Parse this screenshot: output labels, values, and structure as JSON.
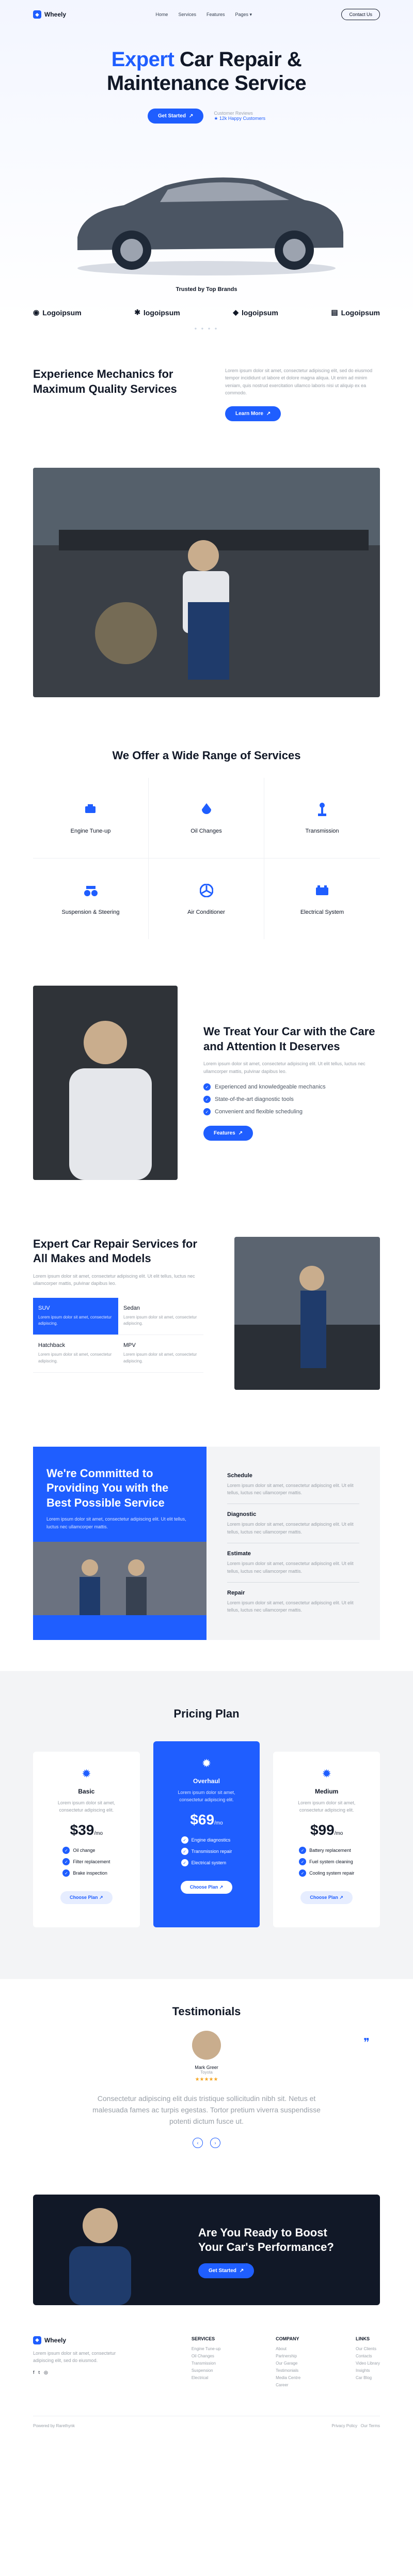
{
  "colors": {
    "accent": "#1f5eff",
    "dark": "#111827",
    "light_bg": "#f3f4f6"
  },
  "nav": {
    "brand": "Wheely",
    "menu": [
      "Home",
      "Services",
      "Features",
      "Pages"
    ],
    "contact": "Contact Us"
  },
  "hero": {
    "title_accent": "Expert",
    "title_rest_1": " Car Repair &",
    "title_rest_2": "Maintenance Service",
    "cta": "Get Started",
    "customers_label": "Customer Reviews",
    "customers_value": "12k Happy Customers"
  },
  "brands": {
    "title": "Trusted by Top Brands",
    "items": [
      "Logoipsum",
      "logoipsum",
      "logoipsum",
      "Logoipsum"
    ]
  },
  "intro": {
    "title": "Experience Mechanics for Maximum Quality Services",
    "body": "Lorem ipsum dolor sit amet, consectetur adipiscing elit, sed do eiusmod tempor incididunt ut labore et dolore magna aliqua. Ut enim ad minim veniam, quis nostrud exercitation ullamco laboris nisi ut aliquip ex ea commodo.",
    "cta": "Learn More"
  },
  "services": {
    "title": "We Offer a Wide Range of Services",
    "items": [
      {
        "label": "Engine Tune-up",
        "icon": "engine-icon"
      },
      {
        "label": "Oil Changes",
        "icon": "oil-icon"
      },
      {
        "label": "Transmission",
        "icon": "transmission-icon"
      },
      {
        "label": "Suspension & Steering",
        "icon": "suspension-icon"
      },
      {
        "label": "Air Conditioner",
        "icon": "fan-icon"
      },
      {
        "label": "Electrical System",
        "icon": "battery-icon"
      }
    ]
  },
  "treat": {
    "title": "We Treat Your Car with the Care and Attention It Deserves",
    "body": "Lorem ipsum dolor sit amet, consectetur adipiscing elit. Ut elit tellus, luctus nec ullamcorper mattis, pulvinar dapibus leo.",
    "checks": [
      "Experienced and knowledgeable mechanics",
      "State-of-the-art diagnostic tools",
      "Convenient and flexible scheduling"
    ],
    "cta": "Features"
  },
  "expert": {
    "title": "Expert Car Repair Services for All Makes and Models",
    "body": "Lorem ipsum dolor sit amet, consectetur adipiscing elit. Ut elit tellus, luctus nec ullamcorper mattis, pulvinar dapibus leo.",
    "types": [
      {
        "name": "SUV",
        "desc": "Lorem ipsum dolor sit amet, consectetur adipiscing."
      },
      {
        "name": "Sedan",
        "desc": "Lorem ipsum dolor sit amet, consectetur adipiscing."
      },
      {
        "name": "Hatchback",
        "desc": "Lorem ipsum dolor sit amet, consectetur adipiscing."
      },
      {
        "name": "MPV",
        "desc": "Lorem ipsum dolor sit amet, consectetur adipiscing."
      }
    ]
  },
  "commit": {
    "title": "We're Committed to Providing You with the Best Possible Service",
    "body": "Lorem ipsum dolor sit amet, consectetur adipiscing elit. Ut elit tellus, luctus nec ullamcorper mattis.",
    "items": [
      {
        "title": "Schedule",
        "desc": "Lorem ipsum dolor sit amet, consectetur adipiscing elit. Ut elit tellus, luctus nec ullamcorper mattis."
      },
      {
        "title": "Diagnostic",
        "desc": "Lorem ipsum dolor sit amet, consectetur adipiscing elit. Ut elit tellus, luctus nec ullamcorper mattis."
      },
      {
        "title": "Estimate",
        "desc": "Lorem ipsum dolor sit amet, consectetur adipiscing elit. Ut elit tellus, luctus nec ullamcorper mattis."
      },
      {
        "title": "Repair",
        "desc": "Lorem ipsum dolor sit amet, consectetur adipiscing elit. Ut elit tellus, luctus nec ullamcorper mattis."
      }
    ]
  },
  "pricing": {
    "title": "Pricing Plan",
    "plans": [
      {
        "name": "Basic",
        "desc": "Lorem ipsum dolor sit amet, consectetur adipiscing elit.",
        "price": "$39",
        "period": "/mo",
        "features": [
          "Oil change",
          "Filter replacement",
          "Brake inspection"
        ],
        "cta": "Choose Plan"
      },
      {
        "name": "Overhaul",
        "desc": "Lorem ipsum dolor sit amet, consectetur adipiscing elit.",
        "price": "$69",
        "period": "/mo",
        "features": [
          "Engine diagnostics",
          "Transmission repair",
          "Electrical system"
        ],
        "cta": "Choose Plan"
      },
      {
        "name": "Medium",
        "desc": "Lorem ipsum dolor sit amet, consectetur adipiscing elit.",
        "price": "$99",
        "period": "/mo",
        "features": [
          "Battery replacement",
          "Fuel system cleaning",
          "Cooling system repair"
        ],
        "cta": "Choose Plan"
      }
    ]
  },
  "testimonials": {
    "title": "Testimonials",
    "name": "Mark Greer",
    "role": "Toyota",
    "stars": "★★★★★",
    "quote": "Consectetur adipiscing elit duis tristique sollicitudin nibh sit. Netus et malesuada fames ac turpis egestas. Tortor pretium viverra suspendisse potenti dictum fusce ut."
  },
  "cta": {
    "title": "Are You Ready to Boost Your Car's Performance?",
    "button": "Get Started"
  },
  "footer": {
    "brand": "Wheely",
    "about": "Lorem ipsum dolor sit amet, consectetur adipiscing elit, sed do eiusmod.",
    "cols": [
      {
        "title": "SERVICES",
        "items": [
          "Engine Tune-up",
          "Oil Changes",
          "Transmission",
          "Suspension",
          "Electrical"
        ]
      },
      {
        "title": "COMPANY",
        "items": [
          "About",
          "Partnership",
          "Our Garage",
          "Testimonials",
          "Media Centre",
          "Career"
        ]
      },
      {
        "title": "LINKS",
        "items": [
          "Our Clients",
          "Contacts",
          "Video Library",
          "Insights",
          "Car Blog"
        ]
      }
    ],
    "copyright": "Powered by Rarethynk",
    "policy": "Privacy Policy",
    "terms": "Our Terms"
  }
}
